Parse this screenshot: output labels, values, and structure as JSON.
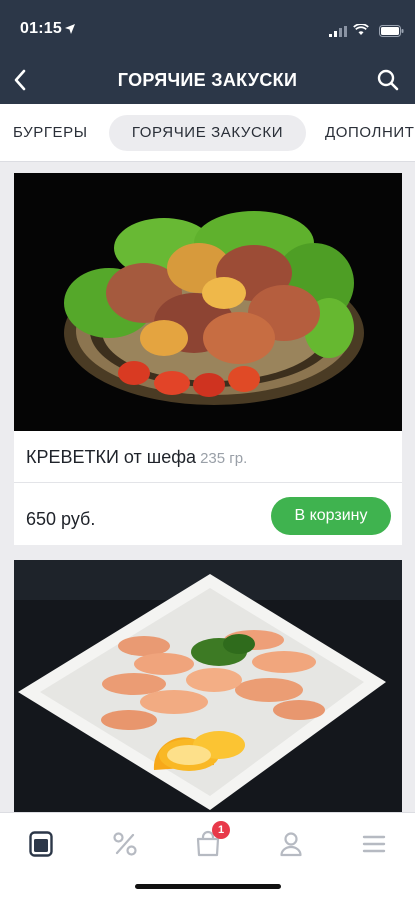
{
  "status_bar": {
    "time": "01:15"
  },
  "header": {
    "title": "ГОРЯЧИЕ ЗАКУСКИ"
  },
  "tabs": [
    {
      "label": "БУРГЕРЫ",
      "active": false
    },
    {
      "label": "ГОРЯЧИЕ ЗАКУСКИ",
      "active": true
    },
    {
      "label": "ДОПОЛНИТ",
      "active": false
    }
  ],
  "products": [
    {
      "name": "КРЕВЕТКИ от шефа",
      "weight": "235 гр.",
      "price": "650 руб.",
      "button_label": "В корзину",
      "image": "bacon-wrapped-shrimp-photo"
    },
    {
      "image": "boiled-shrimp-plate-photo"
    }
  ],
  "bottom_nav": {
    "items": [
      {
        "icon": "menu-book-icon",
        "active": true
      },
      {
        "icon": "percent-icon",
        "active": false
      },
      {
        "icon": "cart-bag-icon",
        "active": false
      },
      {
        "icon": "profile-icon",
        "active": false
      },
      {
        "icon": "hamburger-icon",
        "active": false
      }
    ],
    "cart_count": "1"
  },
  "colors": {
    "header_bg": "#2c3748",
    "accent_green": "#3fb34f",
    "badge_red": "#e8394a",
    "page_bg": "#ececef"
  }
}
